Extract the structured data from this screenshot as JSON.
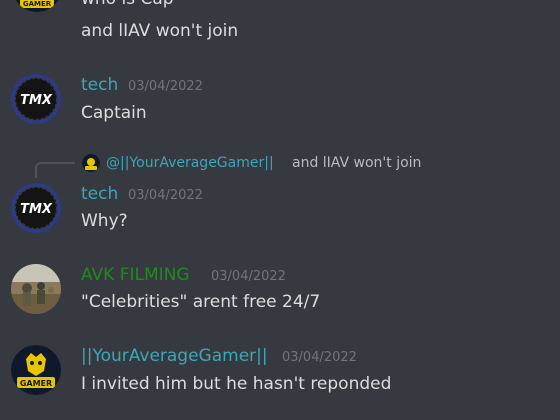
{
  "colors": {
    "background": "#36393f",
    "message_text": "#dcddde",
    "timestamp": "#72767d",
    "tech_name": "#3ba7b8",
    "avk_name": "#1f8b1f",
    "gamer_name": "#3ba7b8",
    "reply_text": "#b9bbbe"
  },
  "top_partial": {
    "text_cut": "who is Cap",
    "line2": "and lIAV won't join"
  },
  "messages": [
    {
      "author": "tech",
      "timestamp": "03/04/2022",
      "content": "Captain",
      "avatar_text": "TMX",
      "avatar_icon": "tmx-logo"
    },
    {
      "reply_author": "@||YourAverageGamer||",
      "reply_text": "and lIAV won't join",
      "author": "tech",
      "timestamp": "03/04/2022",
      "content": "Why?",
      "avatar_text": "TMX",
      "avatar_icon": "tmx-logo"
    },
    {
      "author": "AVK FILMING",
      "timestamp": "03/04/2022",
      "content": "\"Celebrities\" arent free 24/7",
      "avatar_icon": "photo-avatar"
    },
    {
      "author": "||YourAverageGamer||",
      "timestamp": "03/04/2022",
      "content": "I invited him but he hasn't reponded",
      "avatar_text": "GAMER",
      "avatar_icon": "gamer-logo"
    }
  ]
}
